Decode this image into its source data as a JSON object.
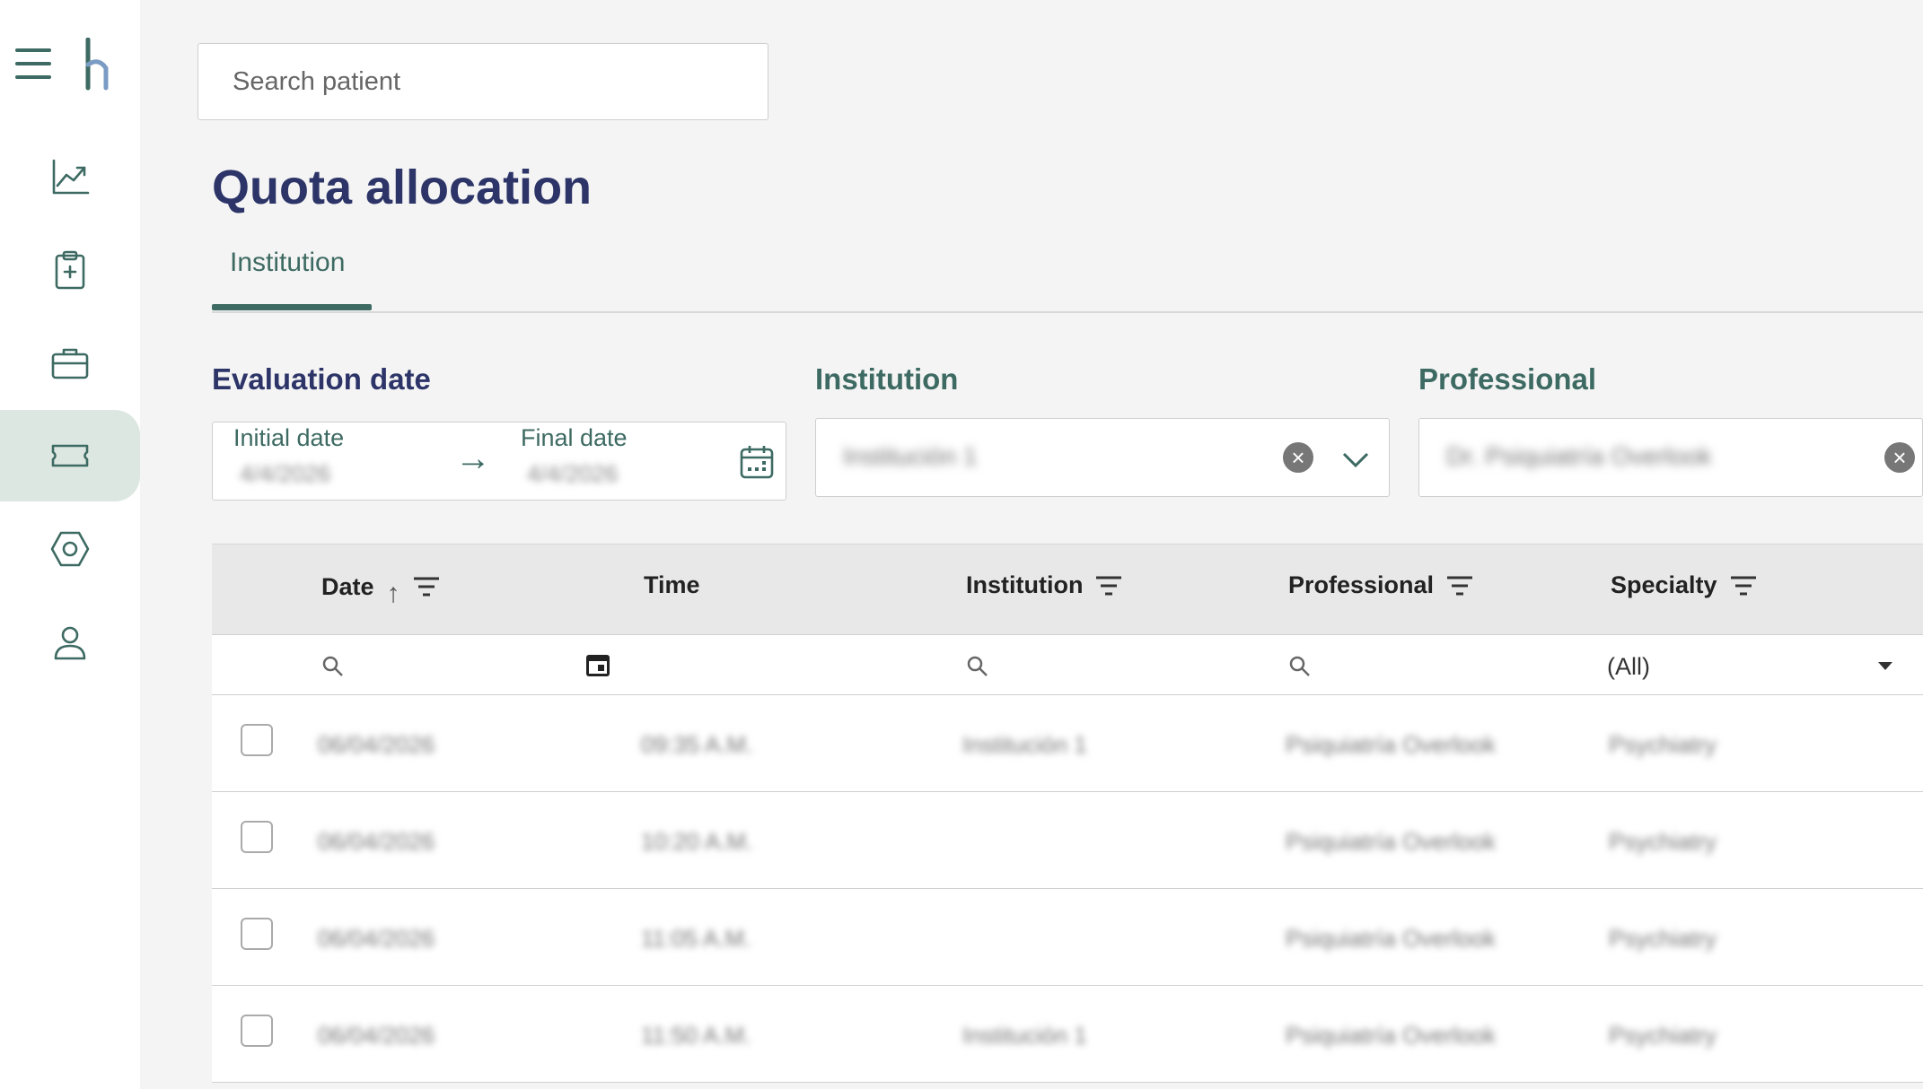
{
  "search": {
    "placeholder": "Search patient"
  },
  "page": {
    "title": "Quota allocation"
  },
  "tabs": [
    {
      "label": "Institution",
      "active": true
    }
  ],
  "filters": {
    "evaluation_date": {
      "label": "Evaluation date",
      "initial_label": "Initial date",
      "initial_value": "4/4/2026",
      "final_label": "Final date",
      "final_value": "4/4/2026"
    },
    "institution": {
      "label": "Institution",
      "value": "Institución 1"
    },
    "professional": {
      "label": "Professional",
      "value": "Dr. Psiquiatría Overlook"
    }
  },
  "grid": {
    "columns": [
      {
        "key": "date",
        "label": "Date",
        "sorted": "ascending"
      },
      {
        "key": "time",
        "label": "Time"
      },
      {
        "key": "institution",
        "label": "Institution"
      },
      {
        "key": "professional",
        "label": "Professional"
      },
      {
        "key": "specialty",
        "label": "Specialty"
      }
    ],
    "specialty_filter": "(All)",
    "rows": [
      {
        "date": "06/04/2026",
        "time": "09:35 A.M.",
        "institution": "Institución 1",
        "professional": "Psiquiatría Overlook",
        "specialty": "Psychiatry"
      },
      {
        "date": "06/04/2026",
        "time": "10:20 A.M.",
        "institution": "",
        "professional": "Psiquiatría Overlook",
        "specialty": "Psychiatry"
      },
      {
        "date": "06/04/2026",
        "time": "11:05 A.M.",
        "institution": "",
        "professional": "Psiquiatría Overlook",
        "specialty": "Psychiatry"
      },
      {
        "date": "06/04/2026",
        "time": "11:50 A.M.",
        "institution": "Institución 1",
        "professional": "Psiquiatría Overlook",
        "specialty": "Psychiatry"
      }
    ]
  },
  "colors": {
    "brand_green": "#3d6a62",
    "title_navy": "#2c3468",
    "active_nav_bg": "#dde7e1"
  },
  "sidebar": {
    "items": [
      {
        "icon": "chart-icon"
      },
      {
        "icon": "clipboard-plus-icon"
      },
      {
        "icon": "briefcase-icon"
      },
      {
        "icon": "ticket-icon",
        "active": true
      },
      {
        "icon": "settings-hexagon-icon"
      },
      {
        "icon": "user-icon"
      }
    ]
  }
}
